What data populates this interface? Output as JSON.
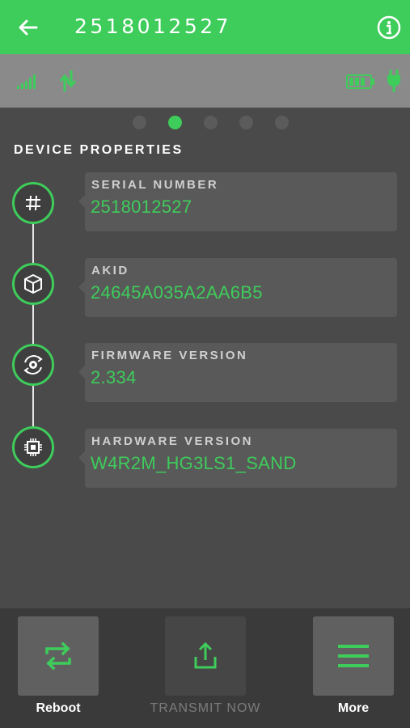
{
  "header": {
    "title": "2518012527",
    "back_icon": "arrow-left-icon",
    "info_icon": "info-circle-icon"
  },
  "status": {
    "signal_icon": "signal-bars-icon",
    "transfer_icon": "sync-arrows-icon",
    "battery_icon": "battery-icon",
    "power_icon": "plug-icon"
  },
  "pager": {
    "count": 5,
    "active_index": 1
  },
  "section_title": "DEVICE PROPERTIES",
  "properties": [
    {
      "label": "SERIAL NUMBER",
      "value": "2518012527",
      "icon": "hash-icon"
    },
    {
      "label": "AKID",
      "value": "24645A035A2AA6B5",
      "icon": "cube-icon"
    },
    {
      "label": "FIRMWARE VERSION",
      "value": "2.334",
      "icon": "gear-sync-icon"
    },
    {
      "label": "HARDWARE VERSION",
      "value": "W4R2M_HG3LS1_SAND",
      "icon": "chip-icon"
    }
  ],
  "actions": {
    "reboot": {
      "label": "Reboot",
      "icon": "swap-arrows-icon"
    },
    "transmit": {
      "label": "TRANSMIT NOW",
      "icon": "upload-icon"
    },
    "more": {
      "label": "More",
      "icon": "menu-icon"
    }
  },
  "colors": {
    "accent": "#3ecc5b",
    "background": "#4a4a4a",
    "status_bar": "#8a8a8a",
    "card": "#595959"
  }
}
